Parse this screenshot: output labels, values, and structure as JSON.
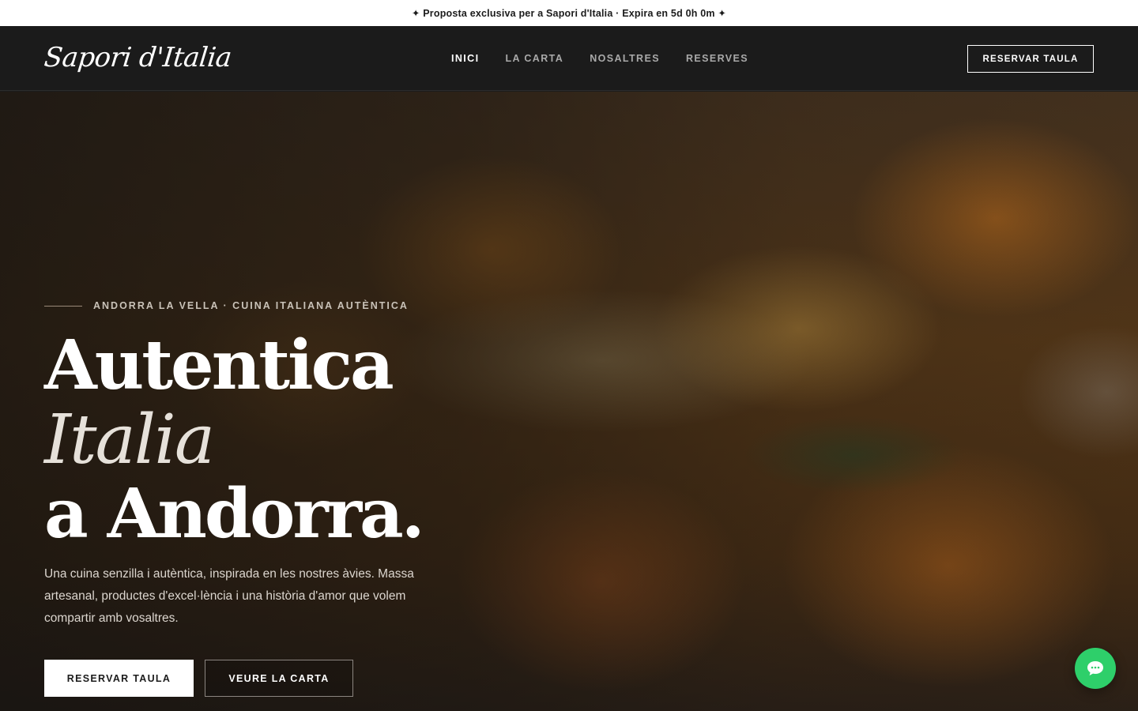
{
  "promo": {
    "text": "✦ Proposta exclusiva per a Sapori d'Italia · Expira en 5d 0h 0m ✦"
  },
  "nav": {
    "logo": "Sapori d'Italia",
    "items": [
      {
        "label": "INICI",
        "active": true
      },
      {
        "label": "LA CARTA",
        "active": false
      },
      {
        "label": "NOSALTRES",
        "active": false
      },
      {
        "label": "RESERVES",
        "active": false
      }
    ],
    "cta": "RESERVAR TAULA"
  },
  "hero": {
    "eyebrow": "ANDORRA LA VELLA · CUINA ITALIANA AUTÈNTICA",
    "line1": "Autentica",
    "line2": "Italia",
    "line3": "a Andorra.",
    "subtitle": "Una cuina senzilla i autèntica, inspirada en les nostres àvies. Massa artesanal, productes d'excel·lència i una història d'amor que volem compartir amb vosaltres.",
    "primary_button": "RESERVAR TAULA",
    "secondary_button": "VEURE LA CARTA",
    "background_image": "blurred-pizza-photo"
  },
  "chat": {
    "icon": "chat-bubble-icon",
    "color": "#2ecf6a"
  }
}
